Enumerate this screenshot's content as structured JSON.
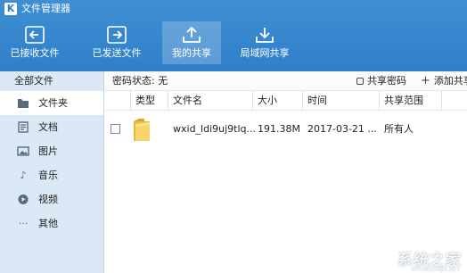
{
  "window": {
    "logo_glyph": "K",
    "title": "文件管理器"
  },
  "toolbar": {
    "buttons": [
      {
        "label": "已接收文件",
        "icon": "received-files-icon",
        "active": false
      },
      {
        "label": "已发送文件",
        "icon": "sent-files-icon",
        "active": false
      },
      {
        "label": "我的共享",
        "icon": "share-upload-icon",
        "active": true
      },
      {
        "label": "局域网共享",
        "icon": "lan-download-icon",
        "active": false
      }
    ]
  },
  "sidebar": {
    "header": "全部文件",
    "items": [
      {
        "label": "文件夹",
        "icon": "folder-icon",
        "active": true
      },
      {
        "label": "文档",
        "icon": "document-icon",
        "active": false
      },
      {
        "label": "图片",
        "icon": "image-icon",
        "active": false
      },
      {
        "label": "音乐",
        "icon": "music-icon",
        "active": false
      },
      {
        "label": "视频",
        "icon": "video-icon",
        "active": false
      },
      {
        "label": "其他",
        "icon": "more-icon",
        "active": false
      }
    ]
  },
  "status": {
    "password_status": "密码状态: 无",
    "share_password": "共享密码",
    "add_share": "添加共享"
  },
  "table": {
    "columns": [
      "类型",
      "文件名",
      "大小",
      "时间",
      "共享范围"
    ],
    "rows": [
      {
        "name": "wxid_ldi9uj9tlq...",
        "size": "191.38M",
        "time": "2017-03-21 ...",
        "scope": "所有人"
      }
    ]
  },
  "watermark": {
    "text": "系统之家",
    "url": "XITONGZHIJIA.NET"
  },
  "colors": {
    "accent": "#2f7fca",
    "sidebar": "#dbe9f6",
    "folder": "#f2c94c"
  }
}
